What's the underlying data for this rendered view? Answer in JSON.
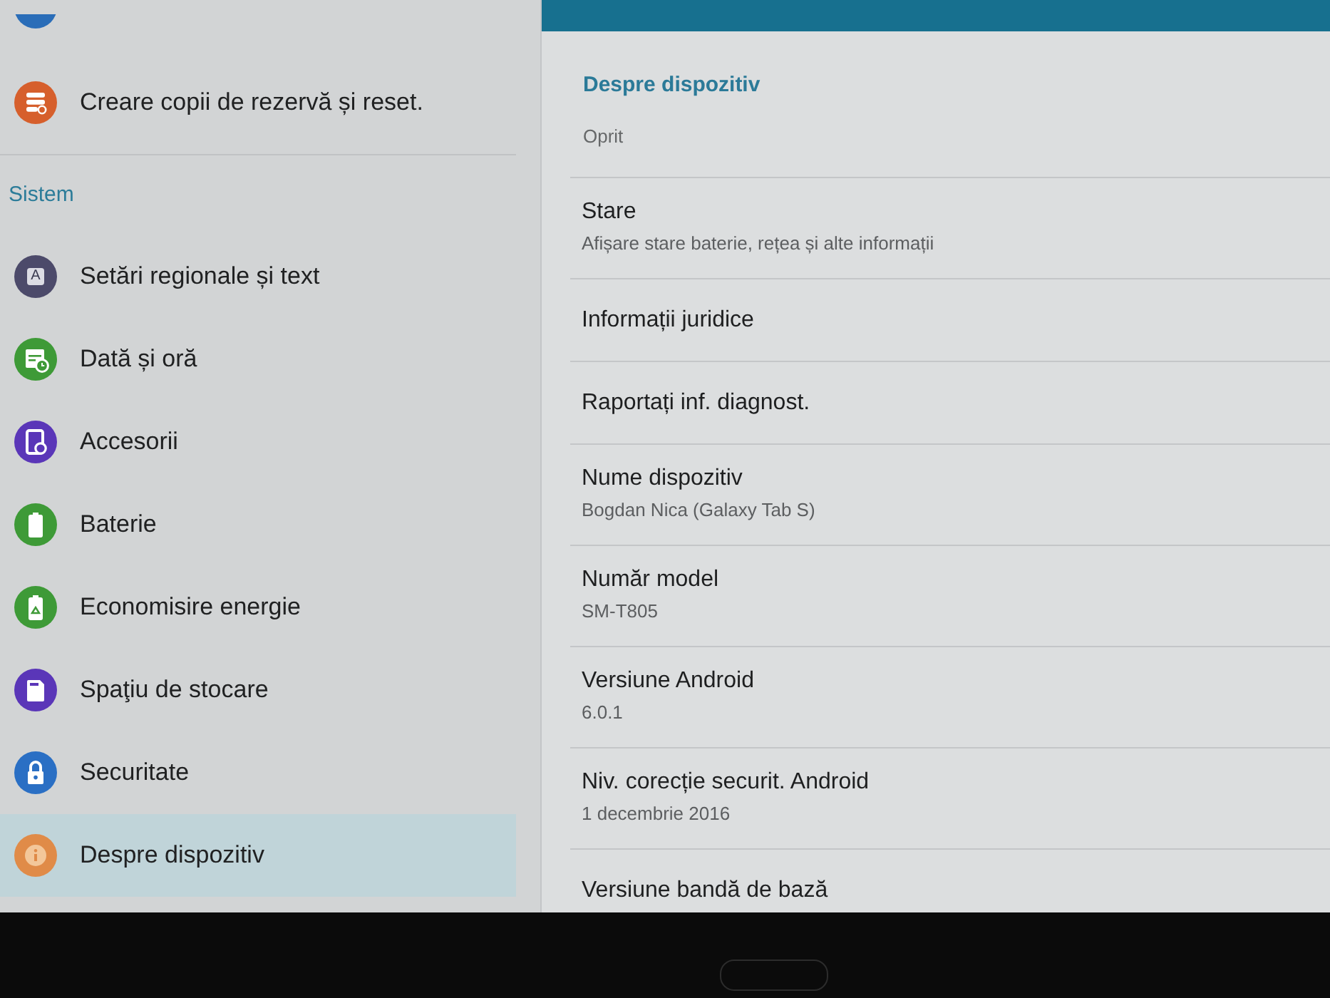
{
  "sidebar": {
    "partial_item": {
      "color": "#2a6db8"
    },
    "groups": [
      {
        "items": [
          {
            "kind": "backup",
            "label": "Creare copii de rezervă și reset.",
            "color": "#d65f2c",
            "selected": false
          }
        ]
      },
      {
        "title": "Sistem",
        "items": [
          {
            "kind": "language",
            "label": "Setări regionale și text",
            "icon_glyph": "A",
            "color": "#4c4a6a",
            "selected": false
          },
          {
            "kind": "datetime",
            "label": "Dată și oră",
            "color": "#3e9a37",
            "selected": false
          },
          {
            "kind": "accessories",
            "label": "Accesorii",
            "color": "#5a36b8",
            "selected": false
          },
          {
            "kind": "battery",
            "label": "Baterie",
            "color": "#3e9a37",
            "selected": false
          },
          {
            "kind": "powersaving",
            "label": "Economisire energie",
            "color": "#3e9a37",
            "selected": false
          },
          {
            "kind": "storage",
            "label": "Spaţiu de stocare",
            "color": "#5a36b8",
            "selected": false
          },
          {
            "kind": "security",
            "label": "Securitate",
            "color": "#2a6fc4",
            "selected": false
          },
          {
            "kind": "about",
            "label": "Despre dispozitiv",
            "color": "#e08b48",
            "selected": true
          }
        ]
      }
    ]
  },
  "detail": {
    "title": "Despre dispozitiv",
    "status": "Oprit",
    "items": [
      {
        "title": "Stare",
        "summary": "Afișare stare baterie, rețea și alte informații"
      },
      {
        "title": "Informații juridice"
      },
      {
        "title": "Raportați inf. diagnost."
      },
      {
        "title": "Nume dispozitiv",
        "summary": "Bogdan Nica (Galaxy Tab S)"
      },
      {
        "title": "Număr model",
        "summary": "SM-T805"
      },
      {
        "title": "Versiune Android",
        "summary": "6.0.1"
      },
      {
        "title": "Niv. corecție securit. Android",
        "summary": "1 decembrie 2016"
      },
      {
        "title": "Versiune bandă de bază"
      }
    ]
  }
}
